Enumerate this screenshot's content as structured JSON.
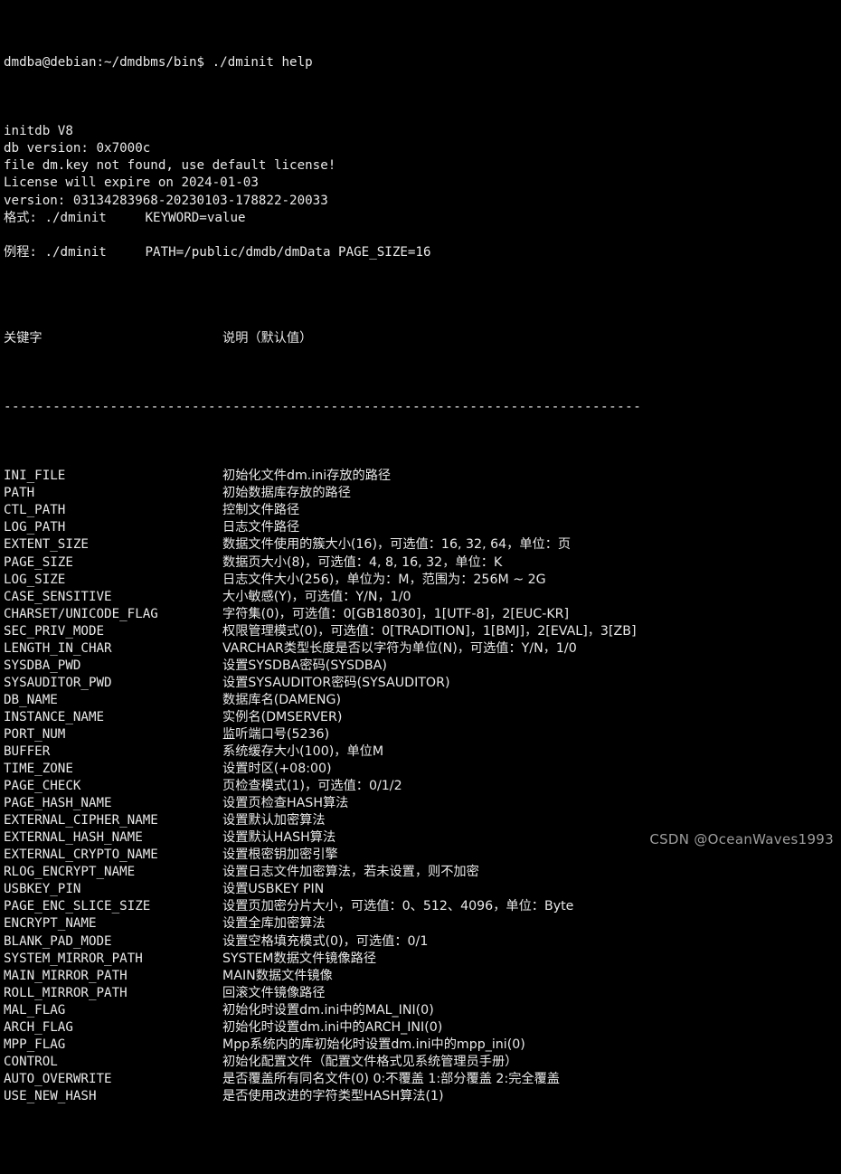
{
  "terminal": {
    "background_color": "#000000",
    "text_color": "#e9e9e9",
    "prompt_line": "dmdba@debian:~/dmdbms/bin$ ./dminit help",
    "header_lines": [
      "initdb V8",
      "db version: 0x7000c",
      "file dm.key not found, use default license!",
      "License will expire on 2024-01-03",
      "version: 03134283968-20230103-178822-20033",
      "格式: ./dminit     KEYWORD=value",
      "",
      "例程: ./dminit     PATH=/public/dmdb/dmData PAGE_SIZE=16",
      ""
    ],
    "table": {
      "col1_header": "关键字",
      "col2_header": "说明（默认值）",
      "separator": "------------------------------------------------------------------------------",
      "rows": [
        {
          "keyword": "INI_FILE",
          "description": "初始化文件dm.ini存放的路径"
        },
        {
          "keyword": "PATH",
          "description": "初始数据库存放的路径"
        },
        {
          "keyword": "CTL_PATH",
          "description": "控制文件路径"
        },
        {
          "keyword": "LOG_PATH",
          "description": "日志文件路径"
        },
        {
          "keyword": "EXTENT_SIZE",
          "description": "数据文件使用的簇大小(16)，可选值：16, 32, 64，单位：页"
        },
        {
          "keyword": "PAGE_SIZE",
          "description": "数据页大小(8)，可选值：4, 8, 16, 32，单位：K"
        },
        {
          "keyword": "LOG_SIZE",
          "description": "日志文件大小(256)，单位为：M，范围为：256M ~ 2G"
        },
        {
          "keyword": "CASE_SENSITIVE",
          "description": "大小敏感(Y)，可选值：Y/N，1/0"
        },
        {
          "keyword": "CHARSET/UNICODE_FLAG",
          "description": "字符集(0)，可选值：0[GB18030]，1[UTF-8]，2[EUC-KR]"
        },
        {
          "keyword": "SEC_PRIV_MODE",
          "description": "权限管理模式(0)，可选值：0[TRADITION]，1[BMJ]，2[EVAL]，3[ZB]"
        },
        {
          "keyword": "LENGTH_IN_CHAR",
          "description": "VARCHAR类型长度是否以字符为单位(N)，可选值：Y/N，1/0"
        },
        {
          "keyword": "SYSDBA_PWD",
          "description": "设置SYSDBA密码(SYSDBA)"
        },
        {
          "keyword": "SYSAUDITOR_PWD",
          "description": "设置SYSAUDITOR密码(SYSAUDITOR)"
        },
        {
          "keyword": "DB_NAME",
          "description": "数据库名(DAMENG)"
        },
        {
          "keyword": "INSTANCE_NAME",
          "description": "实例名(DMSERVER)"
        },
        {
          "keyword": "PORT_NUM",
          "description": "监听端口号(5236)"
        },
        {
          "keyword": "BUFFER",
          "description": "系统缓存大小(100)，单位M"
        },
        {
          "keyword": "TIME_ZONE",
          "description": "设置时区(+08:00)"
        },
        {
          "keyword": "PAGE_CHECK",
          "description": "页检查模式(1)，可选值：0/1/2"
        },
        {
          "keyword": "PAGE_HASH_NAME",
          "description": "设置页检查HASH算法"
        },
        {
          "keyword": "EXTERNAL_CIPHER_NAME",
          "description": "设置默认加密算法"
        },
        {
          "keyword": "EXTERNAL_HASH_NAME",
          "description": "设置默认HASH算法"
        },
        {
          "keyword": "EXTERNAL_CRYPTO_NAME",
          "description": "设置根密钥加密引擎"
        },
        {
          "keyword": "RLOG_ENCRYPT_NAME",
          "description": "设置日志文件加密算法，若未设置，则不加密"
        },
        {
          "keyword": "USBKEY_PIN",
          "description": "设置USBKEY PIN"
        },
        {
          "keyword": "PAGE_ENC_SLICE_SIZE",
          "description": "设置页加密分片大小，可选值：0、512、4096，单位：Byte"
        },
        {
          "keyword": "ENCRYPT_NAME",
          "description": "设置全库加密算法"
        },
        {
          "keyword": "BLANK_PAD_MODE",
          "description": "设置空格填充模式(0)，可选值：0/1"
        },
        {
          "keyword": "SYSTEM_MIRROR_PATH",
          "description": "SYSTEM数据文件镜像路径"
        },
        {
          "keyword": "MAIN_MIRROR_PATH",
          "description": "MAIN数据文件镜像"
        },
        {
          "keyword": "ROLL_MIRROR_PATH",
          "description": "回滚文件镜像路径"
        },
        {
          "keyword": "MAL_FLAG",
          "description": "初始化时设置dm.ini中的MAL_INI(0)"
        },
        {
          "keyword": "ARCH_FLAG",
          "description": "初始化时设置dm.ini中的ARCH_INI(0)"
        },
        {
          "keyword": "MPP_FLAG",
          "description": "Mpp系统内的库初始化时设置dm.ini中的mpp_ini(0)"
        },
        {
          "keyword": "CONTROL",
          "description": "初始化配置文件（配置文件格式见系统管理员手册）"
        },
        {
          "keyword": "AUTO_OVERWRITE",
          "description": "是否覆盖所有同名文件(0) 0:不覆盖 1:部分覆盖 2:完全覆盖"
        },
        {
          "keyword": "USE_NEW_HASH",
          "description": "是否使用改进的字符类型HASH算法(1)"
        }
      ]
    },
    "watermark": "CSDN @OceanWaves1993"
  }
}
